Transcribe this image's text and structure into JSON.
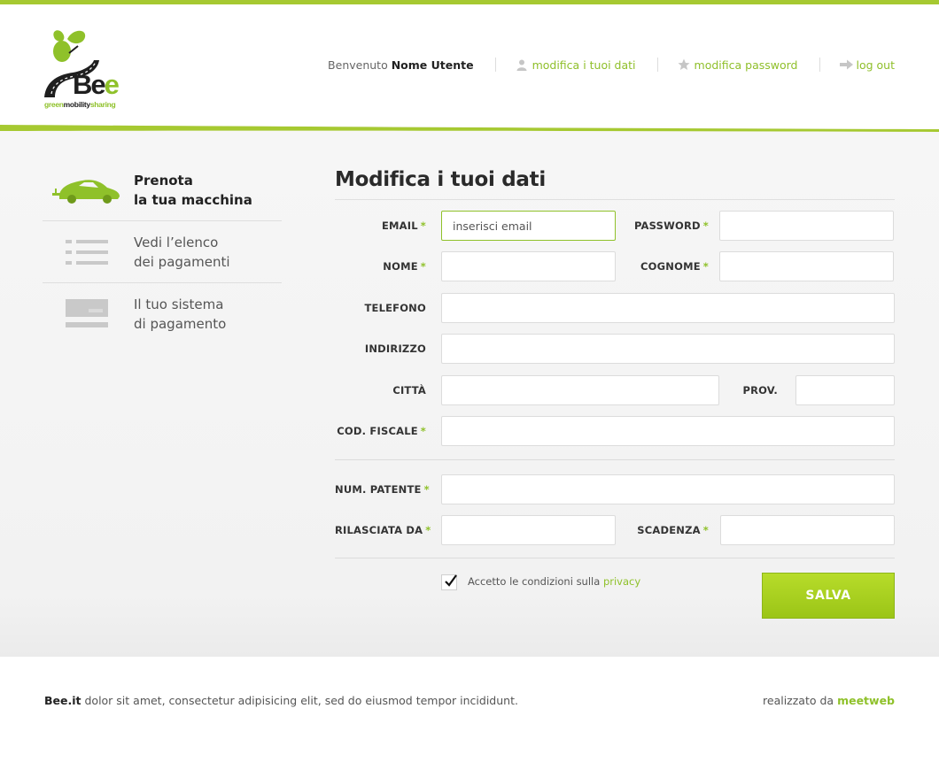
{
  "brand": {
    "logo_word_dark": "Be",
    "logo_word_green": "e",
    "tag_green1": "green",
    "tag_dark": "mobility",
    "tag_green2": "sharing",
    "accent_color": "#a6c931"
  },
  "nav": {
    "welcome": "Benvenuto",
    "username": "Nome Utente",
    "edit_data": "modifica i tuoi dati",
    "edit_password": "modifica password",
    "logout": "log out",
    "icons": [
      "user-icon",
      "star-icon",
      "logout-arrow-icon"
    ]
  },
  "sidebar": {
    "items": [
      {
        "label": "Prenota\nla tua macchina",
        "icon": "car-icon",
        "active": true
      },
      {
        "label": "Vedi l’elenco\ndei pagamenti",
        "icon": "list-icon",
        "active": false
      },
      {
        "label": "Il tuo sistema\ndi pagamento",
        "icon": "credit-card-icon",
        "active": false
      }
    ]
  },
  "form": {
    "title": "Modifica i tuoi dati",
    "email_label": "EMAIL",
    "email_placeholder": "inserisci email",
    "password_label": "PASSWORD",
    "nome_label": "NOME",
    "cognome_label": "COGNOME",
    "telefono_label": "TELEFONO",
    "indirizzo_label": "INDIRIZZO",
    "citta_label": "CITTÀ",
    "prov_label": "PROV.",
    "cod_fiscale_label": "COD. FISCALE",
    "patente_label": "NUM. PATENTE",
    "rilasciata_label": "RILASCIATA DA",
    "scadenza_label": "SCADENZA",
    "required_mark": "*",
    "privacy_text": "Accetto le condizioni sulla",
    "privacy_link": "privacy",
    "privacy_checked": true,
    "save_label": "SALVA"
  },
  "footer": {
    "brand": "Bee.it",
    "text": "dolor sit amet, consectetur adipisicing elit, sed do eiusmod tempor incididunt.",
    "credit_prefix": "realizzato da",
    "credit_name": "meetweb"
  }
}
